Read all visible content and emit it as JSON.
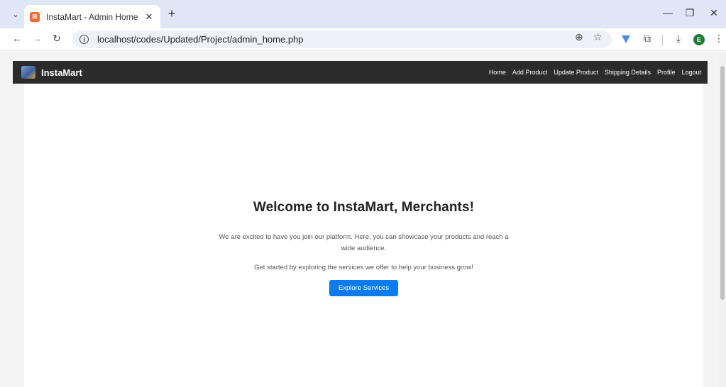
{
  "browser": {
    "tab_title": "InstaMart - Admin Home",
    "tab_close": "✕",
    "new_tab": "+",
    "url": "localhost/codes/Updated/Project/admin_home.php",
    "profile_initial": "E",
    "favicon_glyph": "⊠"
  },
  "site": {
    "brand": "InstaMart",
    "nav": [
      "Home",
      "Add Product",
      "Update Product",
      "Shipping Details",
      "Profile",
      "Logout"
    ]
  },
  "content": {
    "heading": "Welcome to InstaMart, Merchants!",
    "intro": "We are excited to have you join our platform. Here, you can showcase your products and reach a wide audience.",
    "cta_text": "Get started by exploring the services we offer to help your business grow!",
    "button_label": "Explore Services"
  },
  "colors": {
    "navbar_bg": "#2b2b2b",
    "primary_button": "#0b7bf2",
    "tabstrip_bg": "#dfe6f5"
  }
}
